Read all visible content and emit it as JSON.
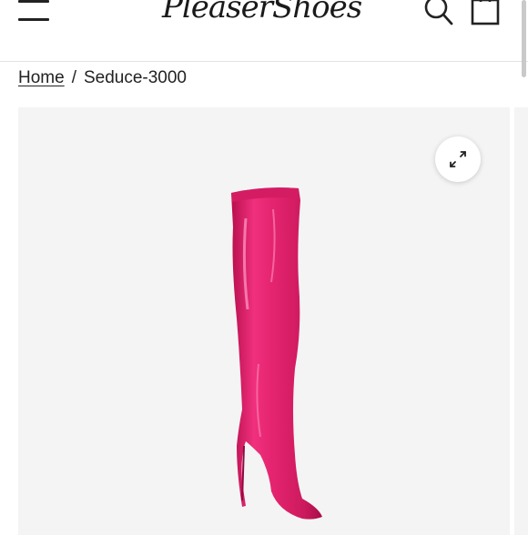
{
  "header": {
    "logo_text": "PleaserShoes",
    "menu_icon": "hamburger-menu-icon",
    "search_icon": "search-icon",
    "cart_icon": "shopping-bag-icon"
  },
  "breadcrumb": {
    "home_label": "Home",
    "separator": "/",
    "current_label": "Seduce-3000"
  },
  "gallery": {
    "expand_icon": "expand-icon",
    "product_image": "pink-thigh-high-boot",
    "product_color": "#e5246f"
  }
}
